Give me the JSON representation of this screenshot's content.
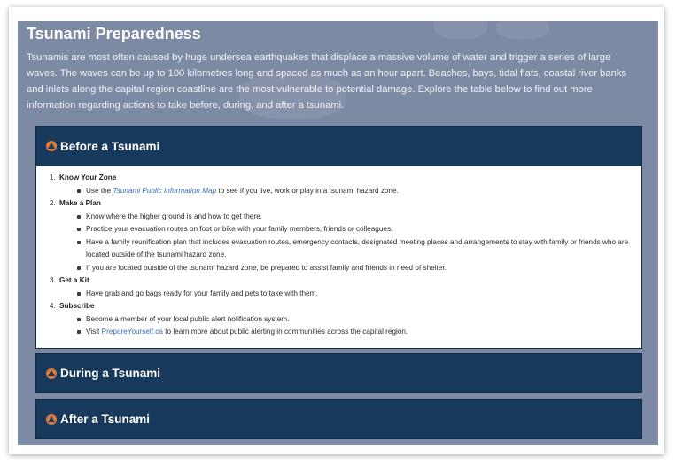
{
  "page": {
    "title": "Tsunami Preparedness",
    "intro": "Tsunamis are most often caused by huge undersea earthquakes that displace a massive volume of water and trigger a series of large waves. The waves can be up to 100 kilometres long and spaced as much as an hour apart. Beaches, bays, tidal flats, coastal river banks and inlets along the capital region coastline are the most vulnerable to potential damage. Explore the table below to find out more information regarding actions to take before, during, and after a tsunami."
  },
  "colors": {
    "panel_bg": "#7d8aa3",
    "header_bg": "#173a5c",
    "icon_orange": "#e07a3a",
    "link": "#3a6bb8"
  },
  "accordion": {
    "before": {
      "label": "Before a Tsunami",
      "expanded": true,
      "icon": "triangle-up-icon",
      "steps": [
        {
          "title": "Know Your Zone",
          "items": [
            {
              "pre": "Use the ",
              "link": "Tsunami Public Information Map",
              "post": " to see if you live, work or play in a tsunami hazard zone."
            }
          ]
        },
        {
          "title": "Make a Plan",
          "items": [
            {
              "text": "Know where the higher ground is and how to get there."
            },
            {
              "text": "Practice your evacuation routes on foot or bike with your family members, friends or colleagues."
            },
            {
              "text": "Have a family reunification plan that includes evacuation routes, emergency contacts, designated meeting places and arrangements to stay with family or friends who are located outside of the tsunami hazard zone."
            },
            {
              "text": "If you are located outside of the tsunami hazard zone, be prepared to assist family and friends in need of shelter."
            }
          ]
        },
        {
          "title": "Get a Kit",
          "items": [
            {
              "text": "Have grab and go bags ready for your family and pets to take with them."
            }
          ]
        },
        {
          "title": "Subscribe",
          "items": [
            {
              "text": "Become a member of your local public alert notification system."
            },
            {
              "pre": "Visit ",
              "link": "PrepareYourself.ca",
              "post": " to learn more about public alerting in communities across the capital region."
            }
          ]
        }
      ]
    },
    "during": {
      "label": "During a Tsunami",
      "expanded": false,
      "icon": "triangle-up-icon"
    },
    "after": {
      "label": "After a Tsunami",
      "expanded": false,
      "icon": "triangle-up-icon"
    }
  }
}
